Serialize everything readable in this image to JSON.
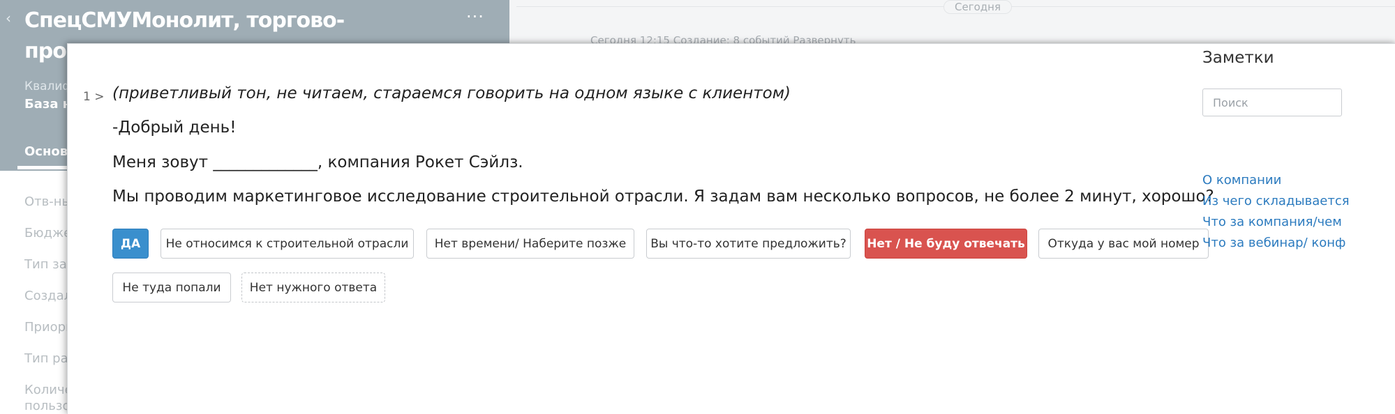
{
  "background": {
    "company_title": "СпецСМУМонолит, торгово-производственная компания",
    "more_label": "···",
    "back_label": "‹",
    "subtitle_1": "Квалификация",
    "subtitle_2": "База номеров",
    "tab_main": "Основное",
    "fields": [
      "Отв-ный",
      "Бюджет",
      "Тип заказа",
      "Создал",
      "Приоритет",
      "Тип работы",
      "Количество",
      "пользователей"
    ],
    "day_label": "Сегодня",
    "event_line": "Сегодня 12:15 Создание: 8 событий Развернуть"
  },
  "script": {
    "step_number": "1 >",
    "intro": "(приветливый тон, не читаем, стараемся говорить на одном языке с клиентом)",
    "line_1": "-Добрый день!",
    "line_2": "Меня зовут _____________, компания Рокет Сэйлз.",
    "line_3": "Мы проводим маркетинговое исследование строительной отрасли. Я задам вам несколько вопросов, не более 2 минут, хорошо?",
    "answers": {
      "yes": "ДА",
      "not_construction": "Не относимся к строительной отрасли",
      "no_time": "Нет времени/ Наберите позже",
      "offer": "Вы что-то хотите предложить?",
      "refuse": "Нет / Не буду отвечать",
      "where_number": "Откуда у вас мой номер",
      "wrong": "Не туда попали",
      "no_answer": "Нет нужного ответа"
    }
  },
  "notes": {
    "title": "Заметки",
    "search_placeholder": "Поиск",
    "links": [
      "О компании",
      "Из чего складывается",
      "Что за компания/чем",
      "Что за вебинар/ конф"
    ]
  },
  "colors": {
    "header_bg": "#9fadb5",
    "yes_button": "#3a8fcd",
    "refuse_button": "#d9534f",
    "link": "#2c7bbf"
  }
}
